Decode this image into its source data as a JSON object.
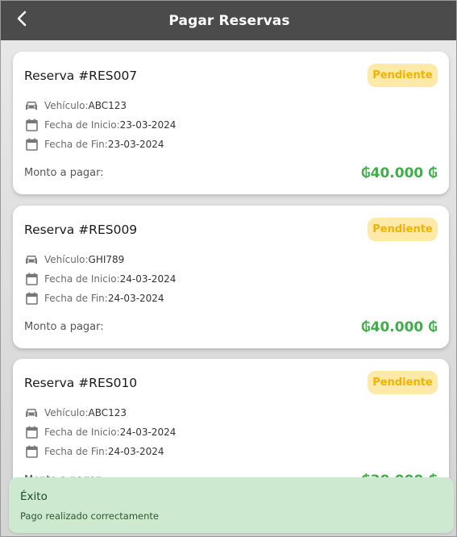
{
  "header": {
    "title": "Pagar Reservas",
    "back_icon": "chevron-left-icon"
  },
  "colors": {
    "appbar": "#4b4b4b",
    "badge_bg": "#fde9a8",
    "badge_text": "#f2b300",
    "amount": "#3fae4a",
    "toast_bg": "#cde9d0"
  },
  "labels": {
    "vehicle": "Vehículo: ",
    "start": "Fecha de Inicio: ",
    "end": "Fecha de Fin: ",
    "amount": "Monto a pagar:"
  },
  "reservations": [
    {
      "title": "Reserva #RES007",
      "status": "Pendiente",
      "vehicle": "ABC123",
      "start_date": "23-03-2024",
      "end_date": "23-03-2024",
      "amount": "₲40.000 ₲"
    },
    {
      "title": "Reserva #RES009",
      "status": "Pendiente",
      "vehicle": "GHI789",
      "start_date": "24-03-2024",
      "end_date": "24-03-2024",
      "amount": "₲40.000 ₲"
    },
    {
      "title": "Reserva #RES010",
      "status": "Pendiente",
      "vehicle": "ABC123",
      "start_date": "24-03-2024",
      "end_date": "24-03-2024",
      "amount": "₲30.000 ₲"
    }
  ],
  "toast": {
    "title": "Éxito",
    "message": "Pago realizado correctamente"
  }
}
